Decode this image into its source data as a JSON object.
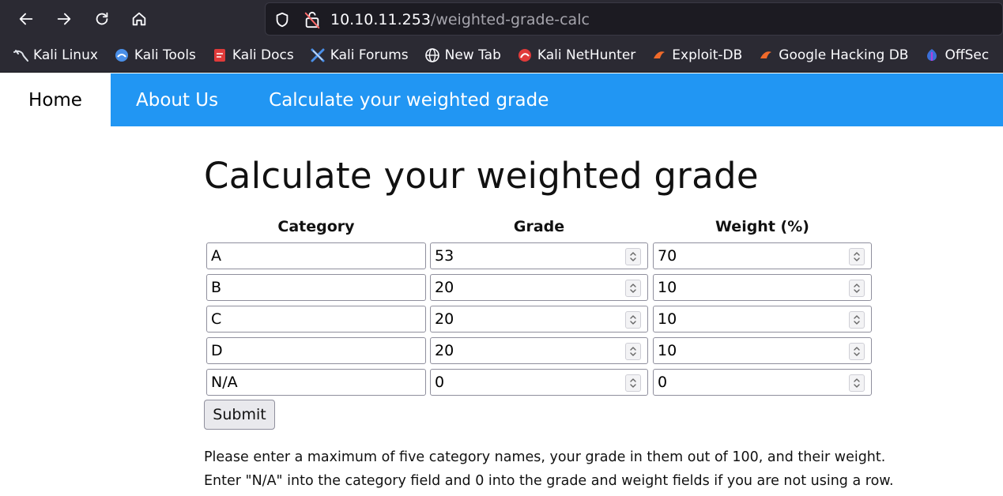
{
  "browser": {
    "url_host": "10.10.11.253",
    "url_path": "/weighted-grade-calc",
    "bookmarks": [
      {
        "label": "Kali Linux",
        "icon": "kali-dragon-icon"
      },
      {
        "label": "Kali Tools",
        "icon": "kali-tools-icon"
      },
      {
        "label": "Kali Docs",
        "icon": "kali-docs-icon"
      },
      {
        "label": "Kali Forums",
        "icon": "kali-forums-icon"
      },
      {
        "label": "New Tab",
        "icon": "globe-icon"
      },
      {
        "label": "Kali NetHunter",
        "icon": "nethunter-icon"
      },
      {
        "label": "Exploit-DB",
        "icon": "exploit-db-icon"
      },
      {
        "label": "Google Hacking DB",
        "icon": "ghdb-icon"
      },
      {
        "label": "OffSec",
        "icon": "offsec-icon"
      }
    ]
  },
  "nav": {
    "home": "Home",
    "about": "About Us",
    "calc": "Calculate your weighted grade"
  },
  "page": {
    "title": "Calculate your weighted grade",
    "headers": {
      "category": "Category",
      "grade": "Grade",
      "weight": "Weight (%)"
    },
    "rows": [
      {
        "category": "A",
        "grade": "53",
        "weight": "70"
      },
      {
        "category": "B",
        "grade": "20",
        "weight": "10"
      },
      {
        "category": "C",
        "grade": "20",
        "weight": "10"
      },
      {
        "category": "D",
        "grade": "20",
        "weight": "10"
      },
      {
        "category": "N/A",
        "grade": "0",
        "weight": "0"
      }
    ],
    "submit": "Submit",
    "help_line1": "Please enter a maximum of five category names, your grade in them out of 100, and their weight.",
    "help_line2": "Enter \"N/A\" into the category field and 0 into the grade and weight fields if you are not using a row."
  },
  "colors": {
    "nav_bg": "#2196f3",
    "chrome_bg": "#2b2a33"
  }
}
